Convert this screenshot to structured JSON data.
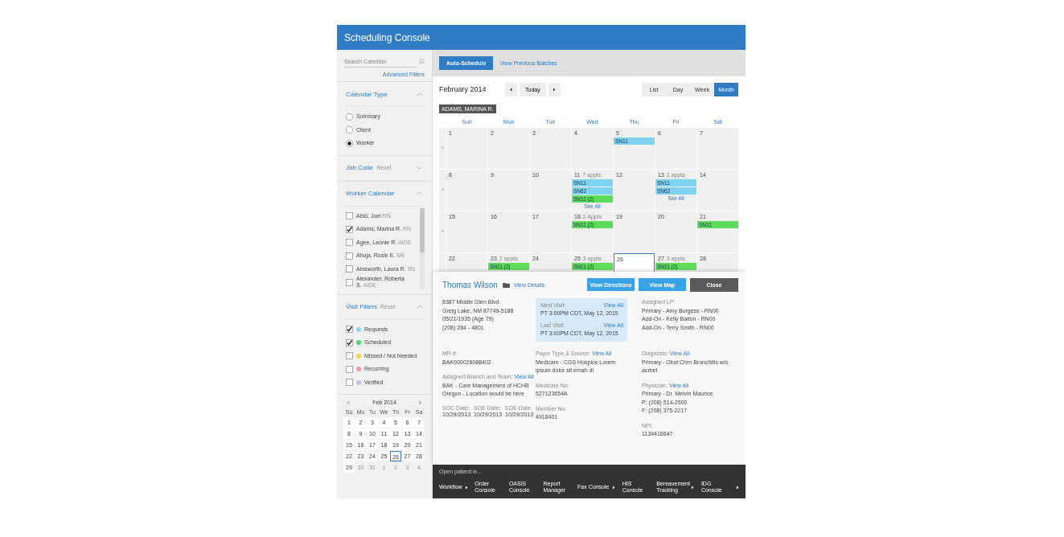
{
  "window": {
    "title": "Scheduling Console"
  },
  "sidebar": {
    "search": {
      "placeholder": "Search Calendar"
    },
    "advanced_filters": "Advanced Filters",
    "sections": [
      {
        "kind": "radio",
        "title": "Calendar Type",
        "expanded": true,
        "options": [
          {
            "label": "Summary",
            "selected": false
          },
          {
            "label": "Client",
            "selected": false
          },
          {
            "label": "Worker",
            "selected": true
          }
        ]
      },
      {
        "title": "Job Code",
        "reset": "Reset",
        "expanded": false
      },
      {
        "kind": "checkbox",
        "title": "Worker Calendar",
        "expanded": true,
        "scroll": true,
        "options": [
          {
            "label": "Abid, Joel",
            "note": "RN",
            "checked": false
          },
          {
            "label": "Adams, Marina R.",
            "note": "RN",
            "checked": true
          },
          {
            "label": "Agee, Leonie R.",
            "note": "AIDE",
            "checked": false
          },
          {
            "label": "Ahuja, Rosie E.",
            "note": "SN",
            "checked": false
          },
          {
            "label": "Ainsworth, Laura R.",
            "note": "SN",
            "checked": false
          },
          {
            "label": "Alexander, Roberta S.",
            "note": "AIDE",
            "checked": false
          }
        ]
      },
      {
        "kind": "checkbox",
        "title": "Visit Filters",
        "reset": "Reset",
        "expanded": true,
        "options": [
          {
            "label": "Requests",
            "checked": true,
            "color": "#8fd8f5"
          },
          {
            "label": "Scheduled",
            "checked": true,
            "color": "#4cd964"
          },
          {
            "label": "Missed / Not Needed",
            "checked": false,
            "color": "#f7d54a"
          },
          {
            "label": "Recurring",
            "checked": false,
            "color": "#f4a0a0"
          },
          {
            "label": "Verified",
            "checked": false,
            "color": "#c9c3ee"
          }
        ]
      }
    ],
    "mini_calendar": {
      "title": "Feb 2014",
      "weekdays": [
        "Su",
        "Mo",
        "Tu",
        "We",
        "Th",
        "Fr",
        "Sa"
      ],
      "weeks": [
        [
          {
            "day": "1",
            "muted": false,
            "selected": false
          },
          {
            "day": "2",
            "muted": false,
            "selected": false
          },
          {
            "day": "3",
            "muted": false,
            "selected": false
          },
          {
            "day": "4",
            "muted": false,
            "selected": false
          },
          {
            "day": "5",
            "muted": false,
            "selected": false
          },
          {
            "day": "6",
            "muted": false,
            "selected": false
          },
          {
            "day": "7",
            "muted": false,
            "selected": false
          }
        ],
        [
          {
            "day": "8",
            "muted": false,
            "selected": false
          },
          {
            "day": "9",
            "muted": false,
            "selected": false
          },
          {
            "day": "10",
            "muted": false,
            "selected": false
          },
          {
            "day": "11",
            "muted": false,
            "selected": false
          },
          {
            "day": "12",
            "muted": false,
            "selected": false
          },
          {
            "day": "13",
            "muted": false,
            "selected": false
          },
          {
            "day": "14",
            "muted": false,
            "selected": false
          }
        ],
        [
          {
            "day": "15",
            "muted": false,
            "selected": false
          },
          {
            "day": "16",
            "muted": false,
            "selected": false
          },
          {
            "day": "17",
            "muted": false,
            "selected": false
          },
          {
            "day": "18",
            "muted": false,
            "selected": false
          },
          {
            "day": "19",
            "muted": false,
            "selected": false
          },
          {
            "day": "20",
            "muted": false,
            "selected": false
          },
          {
            "day": "21",
            "muted": false,
            "selected": false
          }
        ],
        [
          {
            "day": "22",
            "muted": false,
            "selected": false
          },
          {
            "day": "23",
            "muted": false,
            "selected": false
          },
          {
            "day": "24",
            "muted": false,
            "selected": false
          },
          {
            "day": "25",
            "muted": false,
            "selected": false
          },
          {
            "day": "26",
            "muted": false,
            "selected": true
          },
          {
            "day": "27",
            "muted": false,
            "selected": false
          },
          {
            "day": "28",
            "muted": false,
            "selected": false
          }
        ],
        [
          {
            "day": "29",
            "muted": false,
            "selected": false
          },
          {
            "day": "30",
            "muted": true,
            "selected": false
          },
          {
            "day": "31",
            "muted": true,
            "selected": false
          },
          {
            "day": "1",
            "muted": true,
            "selected": false
          },
          {
            "day": "2",
            "muted": true,
            "selected": false
          },
          {
            "day": "3",
            "muted": true,
            "selected": false
          },
          {
            "day": "4",
            "muted": true,
            "selected": false
          }
        ]
      ]
    }
  },
  "toolbar": {
    "buttons": [
      {
        "label": "Auto-Schedule",
        "kind": "primary"
      },
      {
        "label": "View Previous Batches",
        "kind": "link"
      }
    ]
  },
  "calendar": {
    "title": "February 2014",
    "today": "Today",
    "views": [
      {
        "label": "List",
        "selected": false
      },
      {
        "label": "Day",
        "selected": false
      },
      {
        "label": "Week",
        "selected": false
      },
      {
        "label": "Month",
        "selected": true
      }
    ],
    "worker_tag": "ADAMS, MARINA R.",
    "weekdays": [
      "Sun",
      "Mon",
      "Tue",
      "Wed",
      "Thu",
      "Fri",
      "Sat"
    ],
    "weeks": [
      {
        "days": [
          {
            "date": "1",
            "selected": false
          },
          {
            "date": "2",
            "selected": false
          },
          {
            "date": "3",
            "selected": false
          },
          {
            "date": "4",
            "selected": false
          },
          {
            "date": "5",
            "selected": false,
            "events": [
              {
                "label": "SN11",
                "color": "#7fd3f0"
              }
            ]
          },
          {
            "date": "6",
            "selected": false
          },
          {
            "date": "7",
            "selected": false
          }
        ]
      },
      {
        "days": [
          {
            "date": "8",
            "selected": false
          },
          {
            "date": "9",
            "selected": false
          },
          {
            "date": "10",
            "selected": false
          },
          {
            "date": "11",
            "count": "7 appts",
            "selected": false,
            "events": [
              {
                "label": "SN11",
                "color": "#7fd3f0"
              },
              {
                "label": "SN62",
                "color": "#7fd3f0"
              },
              {
                "label": "SN11 (2)",
                "color": "#5ddc5c"
              }
            ],
            "see_all": "See All"
          },
          {
            "date": "12",
            "selected": false
          },
          {
            "date": "13",
            "count": "2 appts",
            "selected": false,
            "events": [
              {
                "label": "SN11",
                "color": "#7fd3f0"
              },
              {
                "label": "SN62",
                "color": "#7fd3f0"
              }
            ],
            "see_all": "See All"
          },
          {
            "date": "14",
            "selected": false
          }
        ]
      },
      {
        "days": [
          {
            "date": "15",
            "selected": false
          },
          {
            "date": "16",
            "selected": false
          },
          {
            "date": "17",
            "selected": false
          },
          {
            "date": "18",
            "count": "2 Appts",
            "selected": false,
            "events": [
              {
                "label": "SN11 (2)",
                "color": "#5ddc5c"
              }
            ]
          },
          {
            "date": "19",
            "selected": false
          },
          {
            "date": "20",
            "selected": false
          },
          {
            "date": "21",
            "selected": false,
            "events": [
              {
                "label": "SN11",
                "color": "#5ddc5c"
              }
            ]
          }
        ]
      },
      {
        "days": [
          {
            "date": "22",
            "selected": false
          },
          {
            "date": "23",
            "count": "2 appts",
            "selected": false,
            "events": [
              {
                "label": "SN11 (2)",
                "color": "#5ddc5c"
              }
            ]
          },
          {
            "date": "24",
            "selected": false
          },
          {
            "date": "25",
            "count": "3 appts",
            "selected": false,
            "events": [
              {
                "label": "SN11 (2)",
                "color": "#5ddc5c"
              }
            ]
          },
          {
            "date": "26",
            "selected": true
          },
          {
            "date": "27",
            "count": "3 appts",
            "selected": false,
            "events": [
              {
                "label": "SN11 (2)",
                "color": "#5ddc5c"
              }
            ]
          },
          {
            "date": "28",
            "selected": false
          }
        ]
      }
    ]
  },
  "patient": {
    "name": "Thomas Wilson",
    "view_details": "View Details",
    "buttons": [
      {
        "label": "View Directions",
        "kind": "primary"
      },
      {
        "label": "View Map",
        "kind": "primary"
      },
      {
        "label": "Close",
        "kind": "dark"
      }
    ],
    "rows": [
      [
        [
          {
            "kind": "lines",
            "lines": [
              "8387 Middle Glen Blvd.",
              "Greig Lake, NM 87749-5188",
              "05/21/1935 (Age 79)",
              "(208) 284 - 4801"
            ]
          }
        ],
        [
          {
            "kind": "visits",
            "visits": [
              {
                "label": "Next Visit:",
                "link": "View All",
                "value": "PT 3:00PM CDT, May 12, 2015"
              },
              {
                "label": "Last Visit:",
                "link": "View All",
                "value": "PT 3:00PM CDT, May 12, 2015"
              }
            ]
          }
        ],
        [
          {
            "kind": "field",
            "label": "Assigned LP:",
            "lines": [
              "Primary - Amy Burgess - RN00",
              "Add-On - Kelly Balton - RN00",
              "Add-On - Terry Smith - RN00"
            ]
          }
        ]
      ],
      [
        [
          {
            "kind": "field",
            "label": "MR #:",
            "lines": [
              "BAK000026088402"
            ]
          },
          {
            "kind": "field",
            "label": "Assigned Branch and Team:",
            "link": "View All",
            "lines": [
              "BAK - Care Management of HCHB",
              "Oregon - Location would be here"
            ]
          },
          {
            "kind": "dates",
            "fields": [
              {
                "label": "SOC Date:",
                "value": "10/29/2013"
              },
              {
                "label": "SOE Date:",
                "value": "10/29/2013"
              },
              {
                "label": "EOE Date:",
                "value": "10/29/2013"
              }
            ]
          }
        ],
        [
          {
            "kind": "field",
            "label": "Payor Type & Source:",
            "link": "View All",
            "lines": [
              "Medicare - CGS Hospice Lorem",
              "ipsum dolor sit emah di"
            ]
          },
          {
            "kind": "field",
            "label": "Medicare No:",
            "lines": [
              "527123654A"
            ]
          },
          {
            "kind": "field",
            "label": "Member No:",
            "lines": [
              "4918401"
            ]
          }
        ],
        [
          {
            "kind": "field",
            "label": "Diagnosis:",
            "link": "View All",
            "lines": [
              "Primary - Obst Chrn Bronchitis w/o acrbet"
            ]
          },
          {
            "kind": "field",
            "label": "Physician:",
            "link": "View All",
            "lines": [
              "Primary - Dr. Melvin Maurice",
              "P: (208) 514-2500",
              "F: (208) 375-2217"
            ]
          },
          {
            "kind": "field",
            "label": "NPI:",
            "lines": [
              "1134416647"
            ]
          }
        ]
      ]
    ]
  },
  "open_in": {
    "title": "Open patient in...",
    "items": [
      {
        "label": "Workflow",
        "menu": true
      },
      {
        "label": "Order Console",
        "menu": false
      },
      {
        "label": "OASIS Console",
        "menu": false
      },
      {
        "label": "Report Manager",
        "menu": false
      },
      {
        "label": "Fax Console",
        "menu": true
      },
      {
        "label": "HIS Console",
        "menu": false
      },
      {
        "label": "Bereavement Tracking",
        "menu": true
      },
      {
        "label": "IDG Console",
        "menu": true
      }
    ]
  }
}
